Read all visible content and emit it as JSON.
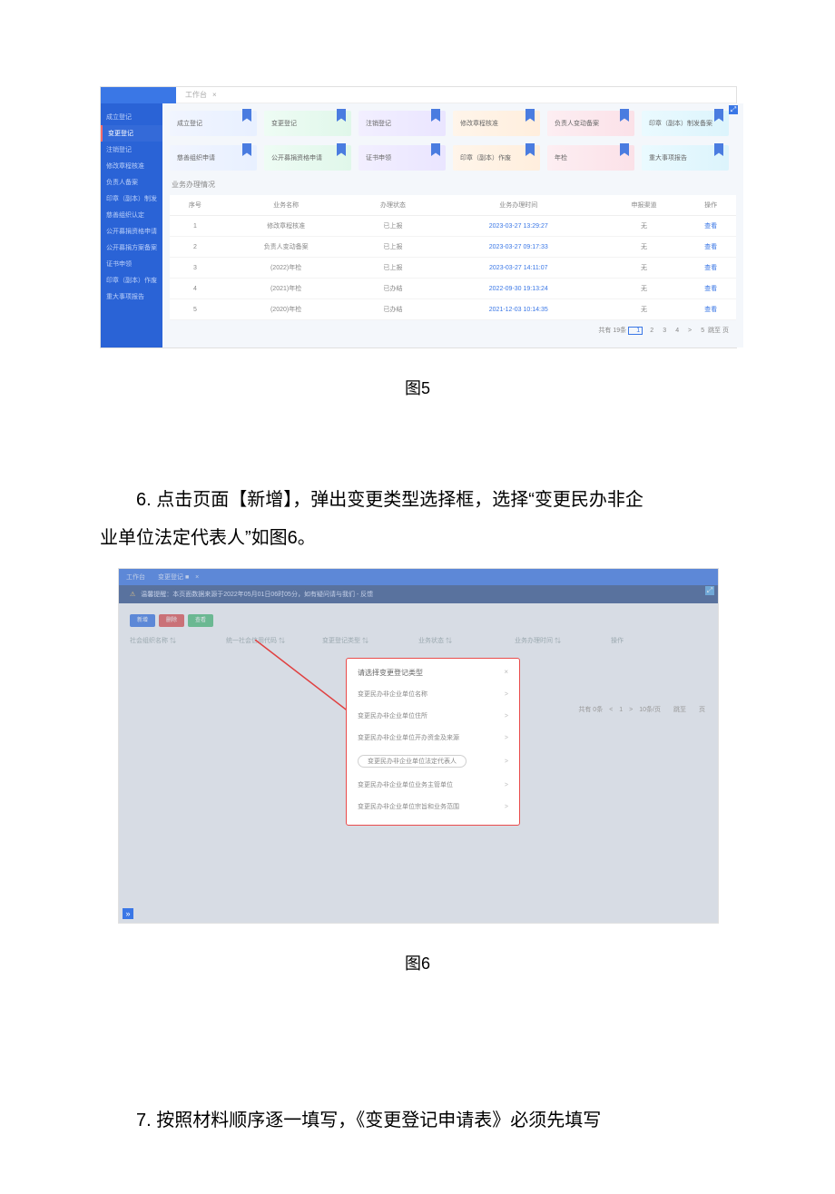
{
  "fig5": {
    "workspace_tab": "工作台",
    "sidebar": [
      {
        "label": "成立登记",
        "hot": false
      },
      {
        "label": "变更登记",
        "hot": true
      },
      {
        "label": "注销登记",
        "hot": false
      },
      {
        "label": "修改章程核准",
        "hot": false
      },
      {
        "label": "负责人备案",
        "hot": false
      },
      {
        "label": "印章（副本）制发",
        "hot": false
      },
      {
        "label": "慈善组织认定",
        "hot": false
      },
      {
        "label": "公开募捐资格申请",
        "hot": false
      },
      {
        "label": "公开募捐方案备案",
        "hot": false
      },
      {
        "label": "证书申领",
        "hot": false
      },
      {
        "label": "印章（副本）作废",
        "hot": false
      },
      {
        "label": "重大事项报告",
        "hot": false
      }
    ],
    "cards_row1": [
      {
        "label": "成立登记",
        "cls": ""
      },
      {
        "label": "变更登记",
        "cls": "green"
      },
      {
        "label": "注销登记",
        "cls": "purple"
      },
      {
        "label": "修改章程核准",
        "cls": "orange"
      },
      {
        "label": "负责人变动备案",
        "cls": "pink"
      },
      {
        "label": "印章（副本）制发备案",
        "cls": "cyan"
      }
    ],
    "cards_row2": [
      {
        "label": "慈善组织申请",
        "cls": ""
      },
      {
        "label": "公开募捐资格申请",
        "cls": "green"
      },
      {
        "label": "证书申领",
        "cls": "purple"
      },
      {
        "label": "印章（副本）作废",
        "cls": "orange"
      },
      {
        "label": "年检",
        "cls": "pink"
      },
      {
        "label": "重大事项报告",
        "cls": "cyan"
      }
    ],
    "section_title": "业务办理情况",
    "table": {
      "headers": [
        "序号",
        "业务名称",
        "办理状态",
        "业务办理时间",
        "申报渠道",
        "操作"
      ],
      "rows": [
        {
          "idx": "1",
          "name": "修改章程核准",
          "status": "已上报",
          "time": "2023-03-27 13:29:27",
          "ch": "无",
          "op": "查看"
        },
        {
          "idx": "2",
          "name": "负责人变动备案",
          "status": "已上报",
          "time": "2023-03-27 09:17:33",
          "ch": "无",
          "op": "查看"
        },
        {
          "idx": "3",
          "name": "(2022)年检",
          "status": "已上报",
          "time": "2023-03-27 14:11:07",
          "ch": "无",
          "op": "查看"
        },
        {
          "idx": "4",
          "name": "(2021)年检",
          "status": "已办结",
          "time": "2022-09-30 19:13:24",
          "ch": "无",
          "op": "查看"
        },
        {
          "idx": "5",
          "name": "(2020)年检",
          "status": "已办结",
          "time": "2021-12-03 10:14:35",
          "ch": "无",
          "op": "查看"
        }
      ]
    },
    "pager": {
      "prefix": "共有 19条",
      "pages": [
        "1",
        "2",
        "3",
        "4",
        ">",
        "5"
      ],
      "suffix": "跳至",
      "suffix2": "页"
    }
  },
  "captions": {
    "fig5": "图5",
    "fig6": "图6"
  },
  "para6_a": "6. 点击页面【新增】，弹出变更类型选择框，选择“变更民办非企",
  "para6_b": "业单位法定代表人”如图6。",
  "fig6": {
    "tabbar": "工作台　　变更登记 ■　×",
    "notice": "温馨提醒：本页面数据来源于2022年05月01日06时05分，如有疑问请与我们 - 反馈",
    "buttons": [
      "新增",
      "删除",
      "查看"
    ],
    "cols": [
      "社会组织名称 ⇅",
      "统一社会信用代码 ⇅",
      "变更登记类型 ⇅",
      "业务状态 ⇅",
      "业务办理时间 ⇅",
      "操作"
    ],
    "modal_title": "请选择变更登记类型",
    "modal_items": [
      "变更民办非企业单位名称",
      "变更民办非企业单位住所",
      "变更民办非企业单位开办资金及来源",
      "变更民办非企业单位法定代表人",
      "变更民办非企业单位业务主管单位",
      "变更民办非企业单位宗旨和业务范围"
    ],
    "modal_highlight_index": 3,
    "pager": "共有 0条　<　1　>　10条/页　　跳至　　页"
  },
  "para7": "7. 按照材料顺序逐一填写，《变更登记申请表》必须先填写"
}
